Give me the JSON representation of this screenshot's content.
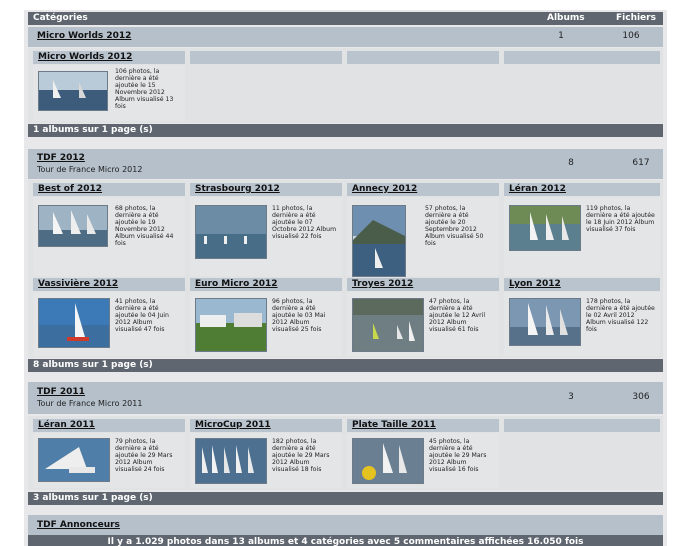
{
  "header": {
    "categories": "Catégories",
    "albums": "Albums",
    "files": "Fichiers"
  },
  "cat1": {
    "title": "Micro Worlds 2012",
    "albums": "1",
    "files": "106",
    "album": {
      "title": "Micro Worlds 2012",
      "info": "106 photos, la dernière a été ajoutée le 15 Novembre 2012 Album visualisé 13 fois"
    },
    "footer": "1 albums sur 1 page (s)"
  },
  "cat2": {
    "title": "TDF 2012",
    "desc": "Tour de France Micro 2012",
    "albums": "8",
    "files": "617",
    "albums_list": [
      {
        "title": "Best of 2012",
        "info": "68 photos, la dernière a été ajoutée le 19 Novembre 2012 Album visualisé 44 fois"
      },
      {
        "title": "Strasbourg 2012",
        "info": "11 photos, la dernière a été ajoutée le 07 Octobre 2012 Album visualisé 22 fois"
      },
      {
        "title": "Annecy 2012",
        "info": "57 photos, la dernière a été ajoutée le 20 Septembre 2012 Album visualisé 50 fois"
      },
      {
        "title": "Léran 2012",
        "info": "119 photos, la dernière a été ajoutée le 18 Juin 2012 Album visualisé 37 fois"
      },
      {
        "title": "Vassivière 2012",
        "info": "41 photos, la dernière a été ajoutée le 04 Juin 2012 Album visualisé 47 fois"
      },
      {
        "title": "Euro Micro 2012",
        "info": "96 photos, la dernière a été ajoutée le 03 Mai 2012 Album visualisé 25 fois"
      },
      {
        "title": "Troyes 2012",
        "info": "47 photos, la dernière a été ajoutée le 12 Avril 2012 Album visualisé 61 fois"
      },
      {
        "title": "Lyon 2012",
        "info": "178 photos, la dernière a été ajoutée le 02 Avril 2012 Album visualisé 122 fois"
      }
    ],
    "footer": "8 albums sur 1 page (s)"
  },
  "cat3": {
    "title": "TDF 2011",
    "desc": "Tour de France Micro 2011",
    "albums": "3",
    "files": "306",
    "albums_list": [
      {
        "title": "Léran 2011",
        "info": "79 photos, la dernière a été ajoutée le 29 Mars 2012 Album visualisé 24 fois"
      },
      {
        "title": "MicroCup 2011",
        "info": "182 photos, la dernière a été ajoutée le 29 Mars 2012 Album visualisé 18 fois"
      },
      {
        "title": "Plate Taille 2011",
        "info": "45 photos, la dernière a été ajoutée le 29 Mars 2012 Album visualisé 16 fois"
      }
    ],
    "footer": "3 albums sur 1 page (s)"
  },
  "cat4": {
    "title": "TDF Annonceurs"
  },
  "stats": "Il y a 1.029 photos dans 13 albums et 4 catégories avec 5 commentaires affichées 16.050 fois"
}
